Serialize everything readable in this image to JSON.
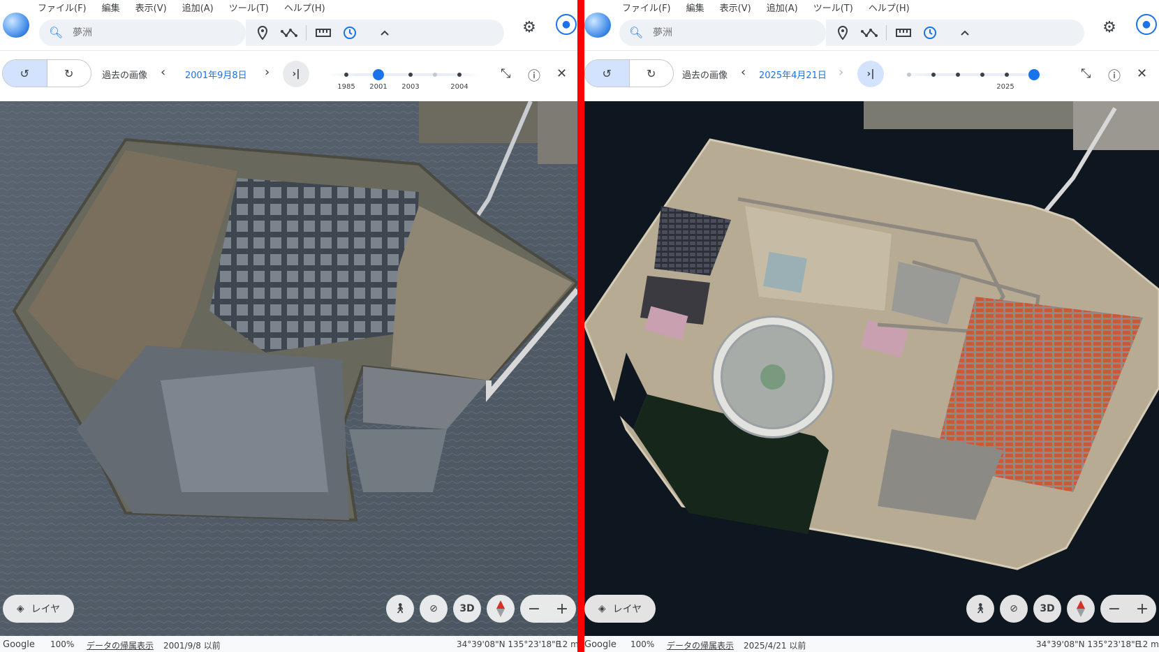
{
  "menu": [
    "ファイル(F)",
    "編集",
    "表示(V)",
    "追加(A)",
    "ツール(T)",
    "ヘルプ(H)"
  ],
  "search": {
    "placeholder": "夢洲"
  },
  "history": {
    "label": "過去の画像"
  },
  "left": {
    "date": "2001年9月8日",
    "timeline": {
      "labels": [
        "1985",
        "2001",
        "2003",
        "2004"
      ],
      "selected": "2001"
    },
    "status": {
      "google": "Google",
      "zoom": "100%",
      "attribution": "データの帰属表示",
      "imagery": "2001/9/8 以前",
      "coords": "34°39'08\"N 135°23'18\"E",
      "alt": "12 m"
    }
  },
  "right": {
    "date": "2025年4月21日",
    "timeline": {
      "labels": [
        "2025"
      ],
      "selected": "2025"
    },
    "status": {
      "google": "Google",
      "zoom": "100%",
      "attribution": "データの帰属表示",
      "imagery": "2025/4/21 以前",
      "coords": "34°39'08\"N 135°23'18\"E",
      "alt": "12 m"
    }
  },
  "controls": {
    "layers": "レイヤ",
    "threed": "3D",
    "zoom_out": "−",
    "zoom_in": "+"
  },
  "colors": {
    "accent": "#1a73e8",
    "divider": "#ff0000"
  }
}
